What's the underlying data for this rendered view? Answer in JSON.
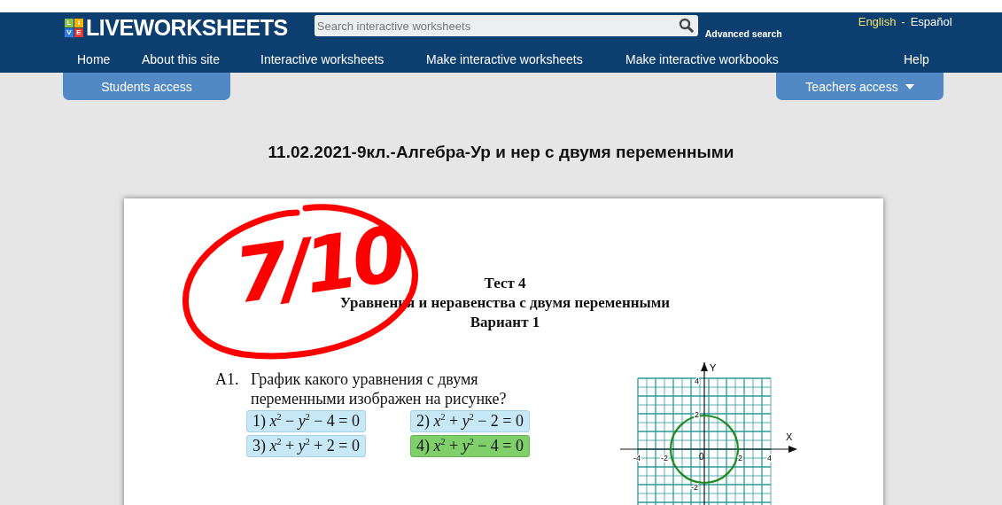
{
  "header": {
    "logo_badge": [
      "L",
      "I",
      "V",
      "E"
    ],
    "logo_text": "LIVEWORKSHEETS",
    "search": {
      "placeholder": "Search interactive worksheets"
    },
    "advanced_search": "Advanced search",
    "languages": [
      {
        "label": "English",
        "selected": true
      },
      {
        "label": "Español",
        "selected": false
      }
    ],
    "language_separator": "-"
  },
  "nav": [
    "Home",
    "About this site",
    "Interactive worksheets",
    "Make interactive worksheets",
    "Make interactive workbooks",
    "Help"
  ],
  "access_tabs": [
    {
      "label": "Students access",
      "dropdown": false
    },
    {
      "label": "Teachers access",
      "dropdown": true
    }
  ],
  "page_title": "11.02.2021-9кл.-Алгебра-Ур и нер с двумя переменными",
  "worksheet": {
    "score": "7/10",
    "heading": [
      "Тест 4",
      "Уравнения и неравенства с двумя переменными",
      "Вариант 1"
    ],
    "question_number": "А1.",
    "question": [
      "График какого уравнения с двумя",
      "переменными изображен на рисунке?"
    ],
    "options": [
      {
        "label": "1)",
        "formula": "*x*$^{2}$ − *y*$^{2}$ − 4 = 0",
        "selected": false
      },
      {
        "label": "2)",
        "formula": "*x*$^{2}$ + *y*$^{2}$ − 2 = 0",
        "selected": false
      },
      {
        "label": "3)",
        "formula": "*x*$^{2}$ + *y*$^{2}$ + 2 = 0",
        "selected": false
      },
      {
        "label": "4)",
        "formula": "*x*$^{2}$ + *y*$^{2}$ − 4 = 0",
        "selected": true
      }
    ],
    "graph": {
      "x_axis": "X",
      "y_axis": "Y",
      "origin": "0",
      "x_ticks": [
        "-4",
        "-2",
        "2",
        "4"
      ],
      "y_ticks": [
        "4",
        "2",
        "-2"
      ]
    }
  }
}
